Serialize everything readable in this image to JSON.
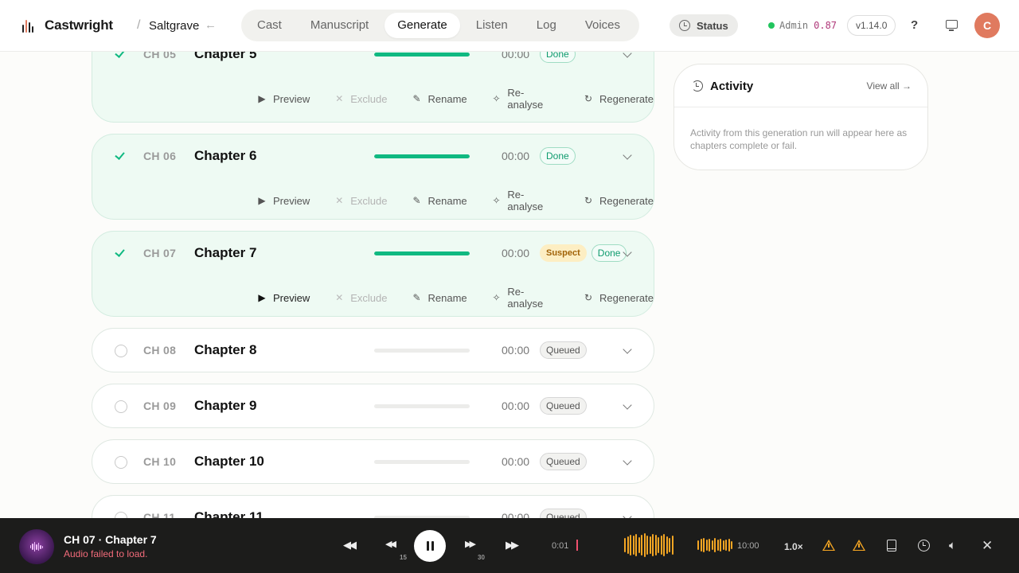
{
  "app": {
    "name": "Castwright",
    "project": "Saltgrave",
    "crumb_sep": "/",
    "back_icon": "arrow-left-icon"
  },
  "nav": {
    "tabs": [
      {
        "label": "Cast",
        "active": false
      },
      {
        "label": "Manuscript",
        "active": false
      },
      {
        "label": "Generate",
        "active": true
      },
      {
        "label": "Listen",
        "active": false
      },
      {
        "label": "Log",
        "active": false
      },
      {
        "label": "Voices",
        "active": false
      }
    ]
  },
  "header": {
    "status_label": "Status",
    "admin_label": "Admin",
    "admin_value": "0.87",
    "version": "v1.14.0",
    "help": "?",
    "avatar_initial": "C"
  },
  "colors": {
    "accent": "#e07a5f",
    "done": "#10b981",
    "warning": "#f5a623",
    "error": "#f26b7a"
  },
  "action_labels": {
    "preview": "Preview",
    "exclude": "Exclude",
    "rename": "Rename",
    "reanalyse": "Re-analyse",
    "regenerate": "Regenerate"
  },
  "chapters": [
    {
      "num": "CH 05",
      "title": "Chapter 5",
      "time": "00:00",
      "state": "done",
      "progress": 1.0,
      "badges": [
        "Done"
      ],
      "expanded": true,
      "preview_active": false
    },
    {
      "num": "CH 06",
      "title": "Chapter 6",
      "time": "00:00",
      "state": "done",
      "progress": 1.0,
      "badges": [
        "Done"
      ],
      "expanded": true,
      "preview_active": false
    },
    {
      "num": "CH 07",
      "title": "Chapter 7",
      "time": "00:00",
      "state": "done",
      "progress": 1.0,
      "badges": [
        "Suspect",
        "Done"
      ],
      "expanded": true,
      "preview_active": true
    },
    {
      "num": "CH 08",
      "title": "Chapter 8",
      "time": "00:00",
      "state": "queued",
      "progress": 0,
      "badges": [
        "Queued"
      ],
      "expanded": false
    },
    {
      "num": "CH 09",
      "title": "Chapter 9",
      "time": "00:00",
      "state": "queued",
      "progress": 0,
      "badges": [
        "Queued"
      ],
      "expanded": false
    },
    {
      "num": "CH 10",
      "title": "Chapter 10",
      "time": "00:00",
      "state": "queued",
      "progress": 0,
      "badges": [
        "Queued"
      ],
      "expanded": false
    },
    {
      "num": "CH 11",
      "title": "Chapter 11",
      "time": "00:00",
      "state": "queued",
      "progress": 0,
      "badges": [
        "Queued"
      ],
      "expanded": false
    }
  ],
  "activity": {
    "title": "Activity",
    "view_all": "View all →",
    "empty_text": "Activity from this generation run will appear here as chapters complete or fail."
  },
  "player": {
    "title": "CH 07 · Chapter 7",
    "subtitle": "Audio failed to load.",
    "rewind_label": "15",
    "forward_label": "30",
    "current_time": "0:01",
    "total_time": "10:00",
    "speed": "1.0×",
    "progress": 0.001
  }
}
